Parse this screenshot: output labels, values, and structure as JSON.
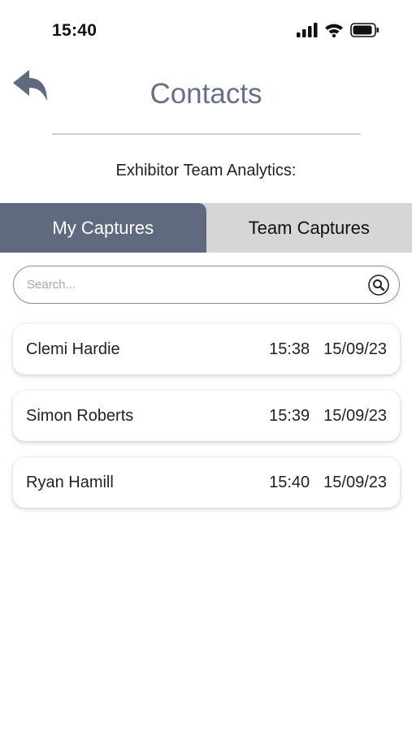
{
  "status_bar": {
    "time": "15:40"
  },
  "header": {
    "title": "Contacts",
    "subtitle": "Exhibitor Team Analytics:"
  },
  "tabs": [
    {
      "label": "My Captures",
      "active": true
    },
    {
      "label": "Team Captures",
      "active": false
    }
  ],
  "search": {
    "placeholder": "Search...",
    "value": ""
  },
  "contacts": [
    {
      "name": "Clemi Hardie",
      "time": "15:38",
      "date": "15/09/23"
    },
    {
      "name": "Simon Roberts",
      "time": "15:39",
      "date": "15/09/23"
    },
    {
      "name": "Ryan Hamill",
      "time": "15:40",
      "date": "15/09/23"
    }
  ],
  "colors": {
    "accent": "#5f6a80",
    "title": "#66708a",
    "tab_inactive": "#d6d6d6"
  },
  "icons": {
    "back": "back-arrow-icon",
    "search": "search-icon",
    "signal": "signal-icon",
    "wifi": "wifi-icon",
    "battery": "battery-icon"
  }
}
